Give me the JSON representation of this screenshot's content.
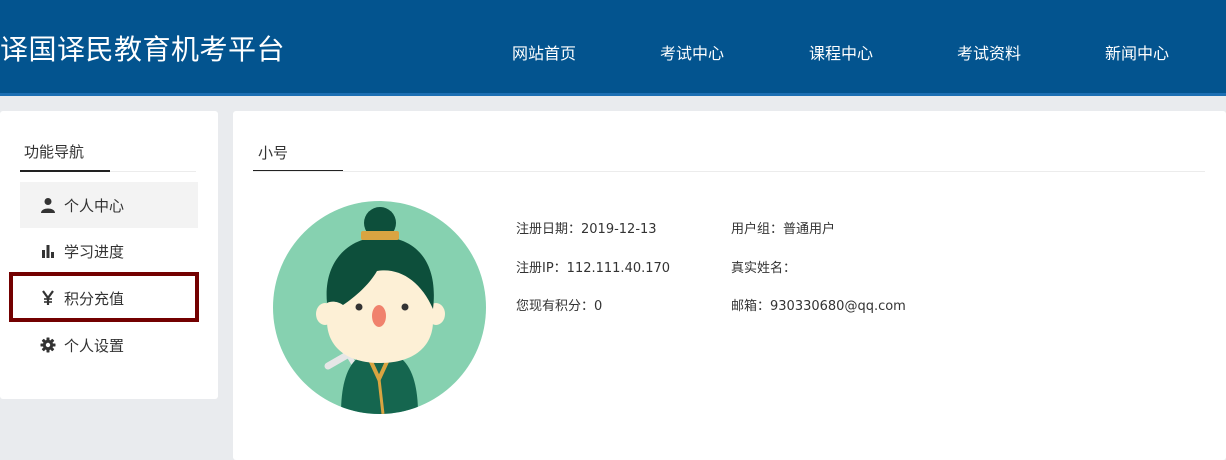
{
  "header": {
    "title": "译国译民教育机考平台",
    "nav": [
      "网站首页",
      "考试中心",
      "课程中心",
      "考试资料",
      "新闻中心"
    ]
  },
  "sidebar": {
    "heading": "功能导航",
    "items": [
      {
        "label": "个人中心",
        "icon": "user-icon",
        "active": true
      },
      {
        "label": "学习进度",
        "icon": "bar-chart-icon",
        "active": false
      },
      {
        "label": "积分充值",
        "icon": "yen-icon",
        "active": false
      },
      {
        "label": "个人设置",
        "icon": "gear-icon",
        "active": false
      }
    ]
  },
  "main": {
    "tab": "小号",
    "info": {
      "reg_date": "注册日期：2019-12-13",
      "user_group": "用户组：普通用户",
      "reg_ip": "注册IP：112.111.40.170",
      "real_name": "真实姓名：",
      "points": "您现有积分：0",
      "email": "邮箱：930330680@qq.com"
    }
  },
  "colors": {
    "header_bg": "#03548f",
    "highlight_border": "#730000",
    "avatar_bg": "#86d1b0"
  }
}
